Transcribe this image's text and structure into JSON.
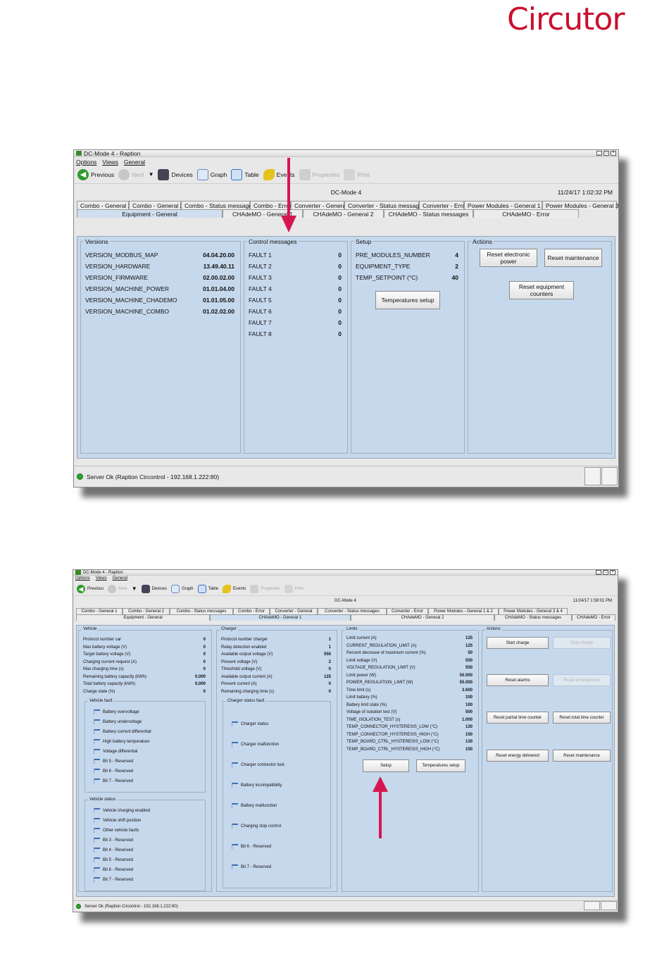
{
  "brand": {
    "logo_text": "Circutor",
    "color": "#c8102e"
  },
  "screen1": {
    "window_title": "DC-Mode 4 - Raption",
    "menu": [
      "Options",
      "Views",
      "General"
    ],
    "toolbar": {
      "previous": "Previous",
      "next": "Next",
      "devices": "Devices",
      "graph": "Graph",
      "table": "Table",
      "events": "Events",
      "properties": "Properties",
      "print": "Print"
    },
    "device_name": "DC-Mode 4",
    "datetime": "11/24/17 1:02:32 PM",
    "tabs_row1": [
      "Combo - General 1",
      "Combo - General 2",
      "Combo - Status messages",
      "Combo - Error",
      "Converter - General",
      "Converter - Status messages",
      "Converter - Error",
      "Power Modules - General 1 & 2",
      "Power Modules - General 3 & 4"
    ],
    "tabs_row2": [
      "Equipment - General",
      "CHAdeMO - General 1",
      "CHAdeMO - General 2",
      "CHAdeMO - Status messages",
      "CHAdeMO - Error"
    ],
    "versions": {
      "title": "Versions",
      "items": [
        {
          "label": "VERSION_MODBUS_MAP",
          "value": "04.04.20.00"
        },
        {
          "label": "VERSION_HARDWARE",
          "value": "13.49.40.11"
        },
        {
          "label": "VERSION_FIRMWARE",
          "value": "02.00.02.00"
        },
        {
          "label": "VERSION_MACHINE_POWER",
          "value": "01.01.04.00"
        },
        {
          "label": "VERSION_MACHINE_CHADEMO",
          "value": "01.01.05.00"
        },
        {
          "label": "VERSION_MACHINE_COMBO",
          "value": "01.02.02.00"
        }
      ]
    },
    "control": {
      "title": "Control messages",
      "items": [
        {
          "label": "FAULT 1",
          "value": "0"
        },
        {
          "label": "FAULT 2",
          "value": "0"
        },
        {
          "label": "FAULT 3",
          "value": "0"
        },
        {
          "label": "FAULT 4",
          "value": "0"
        },
        {
          "label": "FAULT 5",
          "value": "0"
        },
        {
          "label": "FAULT 6",
          "value": "0"
        },
        {
          "label": "FAULT 7",
          "value": "0"
        },
        {
          "label": "FAULT 8",
          "value": "0"
        }
      ]
    },
    "setup": {
      "title": "Setup",
      "items": [
        {
          "label": "PRE_MODULES_NUMBER",
          "value": "4"
        },
        {
          "label": "EQUIPMENT_TYPE",
          "value": "2"
        },
        {
          "label": "TEMP_SETPOINT (°C)",
          "value": "40"
        }
      ],
      "temp_button": "Temperatures setup"
    },
    "actions": {
      "title": "Actions",
      "reset_power": "Reset electronic power",
      "reset_maintenance": "Reset maintenance",
      "reset_counters": "Reset equipment counters"
    },
    "status": "Server Ok (Raption Circontrol - 192.168.1.222:80)"
  },
  "screen2": {
    "window_title": "DC-Mode 4 - Raption",
    "menu": [
      "Options",
      "Views",
      "General"
    ],
    "toolbar": {
      "previous": "Previous",
      "next": "Next",
      "devices": "Devices",
      "graph": "Graph",
      "table": "Table",
      "events": "Events",
      "properties": "Properties",
      "print": "Print"
    },
    "device_name": "DC-Mode 4",
    "datetime": "11/24/17 1:58:01 PM",
    "tabs_row1": [
      "Combo - General 1",
      "Combo - General 2",
      "Combo - Status messages",
      "Combo - Error",
      "Converter - General",
      "Converter - Status messages",
      "Converter - Error",
      "Power Modules - General 1 & 2",
      "Power Modules - General 3 & 4"
    ],
    "tabs_row2": [
      "Equipment - General",
      "CHAdeMO - General 1",
      "CHAdeMO - General 2",
      "CHAdeMO - Status messages",
      "CHAdeMO - Error"
    ],
    "vehicle": {
      "title": "Vehicle",
      "items": [
        {
          "label": "Protocol number car",
          "value": "0"
        },
        {
          "label": "Max battery voltage (V)",
          "value": "0"
        },
        {
          "label": "Target battery voltage (V)",
          "value": "0"
        },
        {
          "label": "Charging current request (A)",
          "value": "0"
        },
        {
          "label": "Max charging time (s)",
          "value": "0"
        },
        {
          "label": "Remaining battery capacity (kWh)",
          "value": "0,000"
        },
        {
          "label": "Total battery capacity (kWh)",
          "value": "0,000"
        },
        {
          "label": "Charge state (%)",
          "value": "0"
        }
      ],
      "fault_title": "Vehicle fault",
      "faults": [
        "Battery overvoltage",
        "Battery undervoltage",
        "Battery current differential",
        "High battery temperature",
        "Voltage differential",
        "Bit  5 - Reserved",
        "Bit  6 - Reserved",
        "Bit  7 - Reserved"
      ],
      "status_title": "Vehicle status",
      "statuses": [
        "Vehicle charging enabled",
        "Vehicle shift position",
        "Other vehicle faults",
        "Bit  3 - Reserved",
        "Bit  4 - Reserved",
        "Bit  5 - Reserved",
        "Bit  6 - Reserved",
        "Bit  7 - Reserved"
      ]
    },
    "charger": {
      "title": "Charger",
      "items": [
        {
          "label": "Protocol number charger",
          "value": "1"
        },
        {
          "label": "Relay detection enabled",
          "value": "1"
        },
        {
          "label": "Available output voltage (V)",
          "value": "550"
        },
        {
          "label": "Present voltage (V)",
          "value": "2"
        },
        {
          "label": "Threshold voltage (V)",
          "value": "0"
        },
        {
          "label": "Available output current (A)",
          "value": "125"
        },
        {
          "label": "Present current (A)",
          "value": "0"
        },
        {
          "label": "Remaining charging time (s)",
          "value": "0"
        }
      ],
      "fault_title": "Charger status fault",
      "faults": [
        "Charger status",
        "Charger malfunction",
        "Charger connector lock",
        "Battery incompatibility",
        "Battery malfunction",
        "Charging stop control",
        "Bit  6 - Reserved",
        "Bit  7 - Reserved"
      ]
    },
    "limits": {
      "title": "Limits",
      "items": [
        {
          "label": "Limit current (A)",
          "value": "125"
        },
        {
          "label": "CURRENT_REGULATION_LIMIT (A)",
          "value": "125"
        },
        {
          "label": "Percent decrease of maximum current (%)",
          "value": "50"
        },
        {
          "label": "Limit voltage (V)",
          "value": "550"
        },
        {
          "label": "VOLTAGE_REGULATION_LIMIT (V)",
          "value": "550"
        },
        {
          "label": "Limit power (W)",
          "value": "50.000"
        },
        {
          "label": "POWER_REGULATION_LIMIT (W)",
          "value": "55.000"
        },
        {
          "label": "Time limit (s)",
          "value": "3.600"
        },
        {
          "label": "Limit battery (%)",
          "value": "100"
        },
        {
          "label": "Battery limit state (%)",
          "value": "100"
        },
        {
          "label": "Voltage of isolation test (V)",
          "value": "500"
        },
        {
          "label": "TIME_ISOLATION_TEST (s)",
          "value": "1.000"
        },
        {
          "label": "TEMP_CONNECTOR_HYSTERESIS_LOW (°C)",
          "value": "130"
        },
        {
          "label": "TEMP_CONNECTOR_HYSTERESIS_HIGH (°C)",
          "value": "150"
        },
        {
          "label": "TEMP_BOARD_CTRL_HYSTERESIS_LOW (°C)",
          "value": "130"
        },
        {
          "label": "TEMP_BOARD_CTRL_HYSTERESIS_HIGH (°C)",
          "value": "150"
        }
      ],
      "setup_button": "Setup",
      "temp_button": "Temperatures setup"
    },
    "actions": {
      "title": "Actions",
      "start_charge": "Start charge",
      "stop_charge": "Stop charge",
      "reset_alarms": "Reset alarms",
      "reset_emergencies": "Reset emergencies",
      "reset_partial_time": "Reset partial time counter",
      "reset_total_time": "Reset total time counter",
      "reset_energy": "Reset energy delivered",
      "reset_maintenance": "Reset maintenance"
    },
    "status": "Server Ok (Raption Circontrol - 192.168.1.222:80)"
  },
  "annotations": {
    "arrow_color": "#d6174f"
  }
}
